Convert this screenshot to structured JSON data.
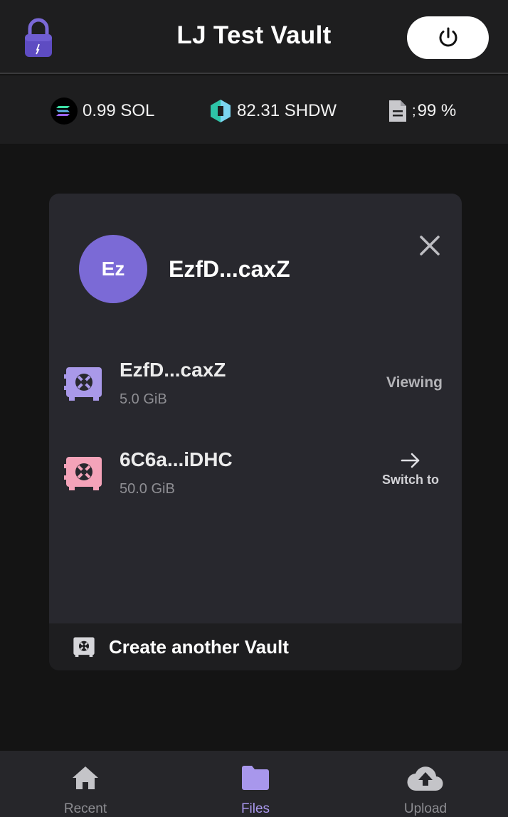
{
  "header": {
    "title": "LJ Test Vault"
  },
  "balances": {
    "sol": "0.99 SOL",
    "shdw": "82.31 SHDW",
    "storage_prefix": ";",
    "storage": "99 %"
  },
  "account": {
    "avatar_initials": "Ez",
    "name": "EzfD...caxZ"
  },
  "vaults": [
    {
      "name": "EzfD...caxZ",
      "size": "5.0 GiB",
      "status": "Viewing",
      "icon_color": "#a999e9"
    },
    {
      "name": "6C6a...iDHC",
      "size": "50.0 GiB",
      "action": "Switch to",
      "icon_color": "#f4a3b9"
    }
  ],
  "create_vault": {
    "label": "Create another Vault"
  },
  "nav": {
    "recent": "Recent",
    "files": "Files",
    "upload": "Upload"
  },
  "colors": {
    "accent": "#a897ec",
    "avatar": "#7b6ad6",
    "lock": "#5e4cc2"
  }
}
